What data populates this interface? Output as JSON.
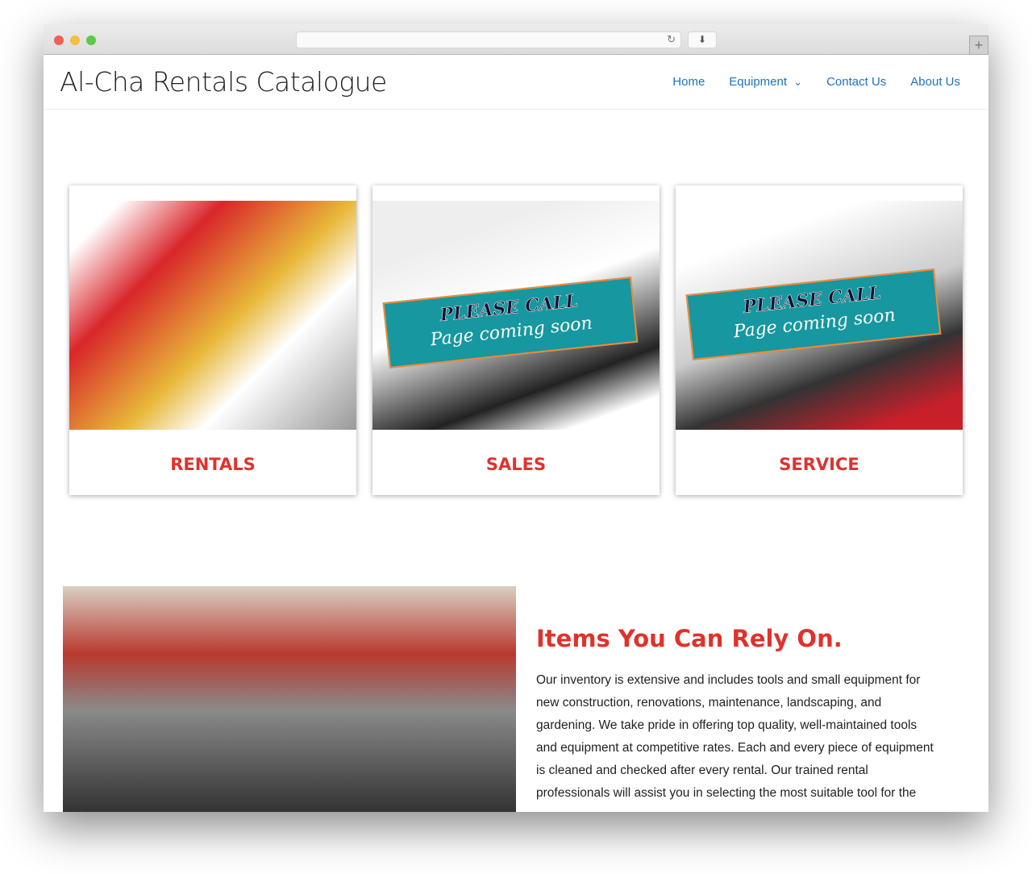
{
  "browser": {
    "reload_icon": "reload-icon",
    "download_icon": "download-icon",
    "new_tab_icon": "plus-icon"
  },
  "site": {
    "title": "Al-Cha Rentals Catalogue"
  },
  "nav": {
    "items": [
      "Home",
      "Equipment",
      "Contact Us",
      "About Us"
    ],
    "chevron": "⌄"
  },
  "cards": [
    {
      "label": "RENTALS"
    },
    {
      "label": "SALES",
      "banner_top": "PLEASE CALL",
      "banner_bottom": "Page coming soon"
    },
    {
      "label": "SERVICE",
      "banner_top": "PLEASE CALL",
      "banner_bottom": "Page coming soon"
    }
  ],
  "section": {
    "heading": "Items You Can Rely On.",
    "body": "Our inventory is extensive and includes tools and small equipment for new construction, renovations, maintenance, landscaping, and gardening. We take pride in offering top quality, well-maintained tools and equipment at competitive rates. Each and every piece of equipment is cleaned and checked after every rental. Our trained rental professionals will assist you in selecting the most suitable tool for the"
  },
  "colors": {
    "accent": "#e0322c",
    "link": "#1e73be",
    "banner": "#17979f"
  }
}
